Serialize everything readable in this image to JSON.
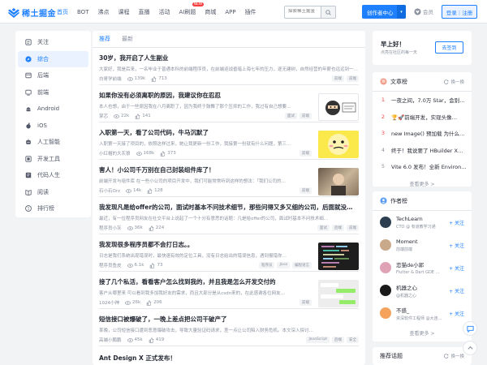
{
  "logo": {
    "text": "稀土掘金"
  },
  "nav": [
    {
      "label": "首页",
      "active": true
    },
    {
      "label": "BOT"
    },
    {
      "label": "沸点"
    },
    {
      "label": "课程"
    },
    {
      "label": "直播"
    },
    {
      "label": "活动"
    },
    {
      "label": "AI刷题",
      "badge": "NEW"
    },
    {
      "label": "商城"
    },
    {
      "label": "APP"
    },
    {
      "label": "插件"
    }
  ],
  "search": {
    "placeholder": "探索稀土掘金"
  },
  "header": {
    "create_label": "创作者中心",
    "vip_label": "会员",
    "login_label": "登录｜注册"
  },
  "sidebar": {
    "items": [
      {
        "label": "关注",
        "icon": "follow-icon"
      },
      {
        "label": "综合",
        "icon": "compass-icon",
        "active": true
      },
      {
        "label": "后端",
        "icon": "backend-icon"
      },
      {
        "label": "前端",
        "icon": "frontend-icon"
      },
      {
        "label": "Android",
        "icon": "android-icon"
      },
      {
        "label": "iOS",
        "icon": "apple-icon"
      },
      {
        "label": "人工智能",
        "icon": "ai-icon"
      },
      {
        "label": "开发工具",
        "icon": "tools-icon"
      },
      {
        "label": "代码人生",
        "icon": "code-life-icon"
      },
      {
        "label": "阅读",
        "icon": "read-icon"
      },
      {
        "label": "排行榜",
        "icon": "rank-icon"
      }
    ]
  },
  "feed": {
    "tabs": [
      {
        "label": "推荐",
        "active": true
      },
      {
        "label": "最新"
      }
    ],
    "articles": [
      {
        "title": "30岁，我开启了人生副业",
        "brief": "大家好，我是后来，一名毕业于普通本科的前端程序员，在前端迎战昏暗上海七年的压力，逐无建树，自然经营的年薪也远远到一…",
        "author": "白哥学前端",
        "views": "139k",
        "likes": "713",
        "tags": [
          "前端",
          "前端"
        ]
      },
      {
        "title": "如果你没有必须离职的原因，我建议你在忍忍",
        "brief": "本人也想，由于一些原因我在八月离职了，因为我终于鼓舞了那个压抑的工作，我过有自己想要…",
        "author": "掌芯",
        "views": "22k",
        "likes": "141",
        "tags": [
          "面试",
          "前端"
        ],
        "thumb": "ninja"
      },
      {
        "title": "入职第一天，看了公司代码，牛马沉默了",
        "brief": "入职第一天接了项目的，依照这样过来，她让我更新一份工作，我接第一份就有什么问题，第三…",
        "author": "小红帽的大灰狼",
        "views": "168k",
        "likes": "373",
        "tags": [
          "前端"
        ],
        "thumb": "yellow"
      },
      {
        "title": "害人！小公司千万别在自己封装组件库了！",
        "brief": "前端开发与组件库 在一些小公司的项目开发中，我们可能常常听到这样的想法：「我们公司的…",
        "author": "石小石Orz",
        "views": "14k",
        "likes": "128",
        "tags": [
          "前端"
        ],
        "thumb": "photo"
      },
      {
        "title": "我发现凡是给offer的公司，面试时基本不问技术细节，那些问得又多又细的公司，后面就没…",
        "brief": "最近，有一位程序员网友在社交平台上说起了一个十分有意思的话题：凡是给offer的公司，面试时基本不问技术细…",
        "author": "程序员小灰",
        "views": "36k",
        "likes": "224",
        "tags": [
          "面试",
          "后端",
          "前端"
        ]
      },
      {
        "title": "我发现很多程序员都不会打日志。。",
        "brief": "日志是我们系统出现错误时，最快速有效的定位工具，没有日志给出的错误信息，遇到报错你…",
        "author": "程序员鱼皮",
        "views": "6.1k",
        "likes": "73",
        "tags": [
          "程序员",
          "Java",
          "编程语言"
        ],
        "thumb": "code"
      },
      {
        "title": "接了几个私活，看看客户怎么找到我的，并且我是怎么开发交付的",
        "brief": "客户从哪里来 可以看到我多加我好友的需求，而且大部分是从csdn来的，在此感谢各位网友…",
        "author": "1024小神",
        "views": "26k",
        "likes": "206",
        "tags": [
          "前端"
        ],
        "thumb": "chat"
      },
      {
        "title": "短信接口被爆破了，一晚上差点把公司干破产了",
        "brief": "某晚，公司短信接口遭到恶意爆破攻击，导致大量验证码请求，差一点让公司陷入财务危机。本文深入探讨…",
        "author": "高端小鹏鹏",
        "views": "45k",
        "likes": "419",
        "tags": [
          "JavaScript",
          "后端",
          "安全"
        ]
      },
      {
        "title": "Ant Design X 正式发布！"
      }
    ]
  },
  "greeting": {
    "title": "早上好！",
    "subtitle": "点亮在社区的每一天",
    "button": "去签到"
  },
  "article_rank": {
    "title": "文章榜",
    "swap_label": "换一换",
    "items": [
      {
        "no": "1",
        "text": "一夜之间，7.0万 Star，会别…"
      },
      {
        "no": "2",
        "text": "🏆🚀前端开发，实现头像…"
      },
      {
        "no": "3",
        "text": "new Image() 预加载 为什么…"
      },
      {
        "no": "4",
        "text": "终于！我说要了 HBuilder X…"
      },
      {
        "no": "5",
        "text": "Vite 6.0 发布！全新 Environ…"
      }
    ],
    "more": "查看更多 >"
  },
  "author_rank": {
    "title": "作者榜",
    "items": [
      {
        "name": "TechLearn",
        "desc": "CTO @ 有道教学习通",
        "color": "#2c3e50"
      },
      {
        "name": "Moment",
        "desc": "前端前端",
        "color": "#c9a98a"
      },
      {
        "name": "恋猫de小郭",
        "desc": "Flutter & Dart GDE …",
        "color": "#e0a3b5"
      },
      {
        "name": "机器之心",
        "desc": "@机器之心",
        "color": "#1a1a1a"
      },
      {
        "name": "不惑_",
        "desc": "资深软件工程师 @大连…",
        "color": "#f5a25d"
      }
    ],
    "follow_label": "+ 关注",
    "more": "查看更多 >"
  },
  "topics": {
    "title": "推荐话题",
    "swap_label": "换一换"
  }
}
